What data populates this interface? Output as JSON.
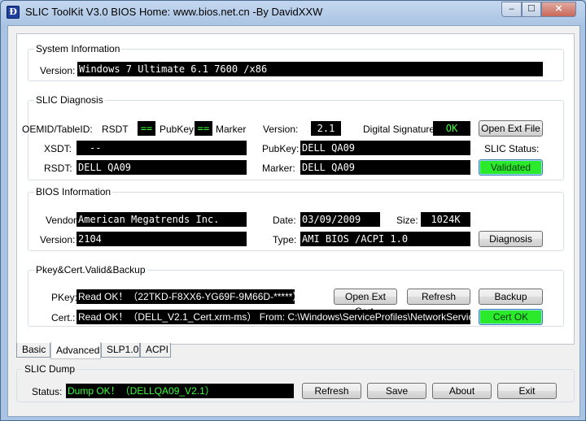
{
  "window": {
    "title": "SLIC ToolKit V3.0      BIOS Home: www.bios.net.cn  -By DavidXXW",
    "icon_glyph": "Ð"
  },
  "icons": {
    "app": "app-icon",
    "minimize": "minimize-icon",
    "maximize": "maximize-icon",
    "close": "close-icon"
  },
  "system_info": {
    "legend": "System Information",
    "version_label": "Version:",
    "version_value": "Windows 7 Ultimate 6.1 7600 /x86"
  },
  "slic_diagnosis": {
    "legend": "SLIC Diagnosis",
    "oemid_label": "OEMID/TableID:",
    "rsdt_word": "RSDT",
    "eq1": "==",
    "pubkey_word": "PubKey",
    "eq2": "==",
    "marker_word": "Marker",
    "version_label": "Version:",
    "version_value": "2.1",
    "digsig_label": "Digital Signature:",
    "digsig_value": "OK",
    "open_ext_file": "Open Ext File",
    "xsdt_label": "XSDT:",
    "xsdt_value": "--",
    "pubkey_label": "PubKey:",
    "pubkey_value": "DELL  QA09",
    "slic_status_label": "SLIC Status:",
    "rsdt_label": "RSDT:",
    "rsdt_value": "DELL  QA09",
    "marker_label": "Marker:",
    "marker_value": "DELL  QA09",
    "validated": "Validated"
  },
  "bios_info": {
    "legend": "BIOS Information",
    "vendor_label": "Vendor:",
    "vendor_value": "American Megatrends Inc.",
    "date_label": "Date:",
    "date_value": "03/09/2009",
    "size_label": "Size:",
    "size_value": "1024K",
    "version_label": "Version:",
    "version_value": "2104",
    "type_label": "Type:",
    "type_value": "AMI BIOS /ACPI 1.0",
    "diagnosis": "Diagnosis"
  },
  "pkey": {
    "legend": "Pkey&Cert.Valid&Backup",
    "pkey_label": "PKey:",
    "pkey_value": "Read OK！（22TKD-F8XX6-YG69F-9M66D-*****）",
    "open_ext_cert": "Open Ext Cert.",
    "refresh": "Refresh",
    "backup": "Backup",
    "cert_label": "Cert.:",
    "cert_value": "Read OK！（DELL_V2.1_Cert.xrm-ms）   From: C:\\Windows\\ServiceProfiles\\NetworkService\\AppData",
    "cert_ok": "Cert  OK"
  },
  "tabs": [
    {
      "label": "Basic"
    },
    {
      "label": "Advanced"
    },
    {
      "label": "SLP1.0"
    },
    {
      "label": "ACPI"
    }
  ],
  "active_tab": "Advanced",
  "slic_dump": {
    "legend": "SLIC Dump",
    "status_label": "Status:",
    "status_value": "Dump OK！（DELLQA09_V2.1）",
    "refresh": "Refresh",
    "save": "Save",
    "about": "About",
    "exit": "Exit"
  },
  "colors": {
    "value_bg": "#000000",
    "value_text": "#ffffff",
    "ok_text": "#3bff3b",
    "status_button": "#2bea2b",
    "window_frame": "#a9c4e3"
  }
}
